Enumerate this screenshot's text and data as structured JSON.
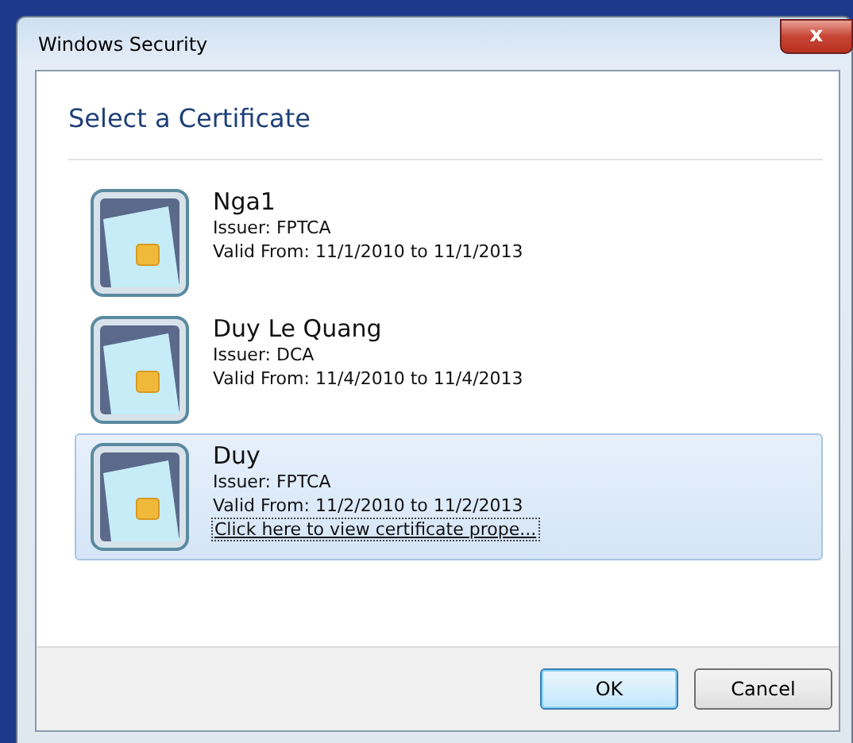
{
  "window": {
    "title": "Windows Security",
    "close_label": "x"
  },
  "heading": "Select a Certificate",
  "certificates": [
    {
      "name": "Nga1",
      "issuer": "Issuer: FPTCA",
      "valid": "Valid From: 11/1/2010 to 11/1/2013",
      "selected": false
    },
    {
      "name": "Duy Le Quang",
      "issuer": "Issuer: DCA",
      "valid": "Valid From: 11/4/2010 to 11/4/2013",
      "selected": false
    },
    {
      "name": "Duy",
      "issuer": "Issuer: FPTCA",
      "valid": "Valid From: 11/2/2010 to 11/2/2013",
      "selected": true,
      "link": "Click here to view certificate prope..."
    }
  ],
  "buttons": [
    {
      "label": "OK",
      "default": true
    },
    {
      "label": "Cancel",
      "default": false
    }
  ]
}
